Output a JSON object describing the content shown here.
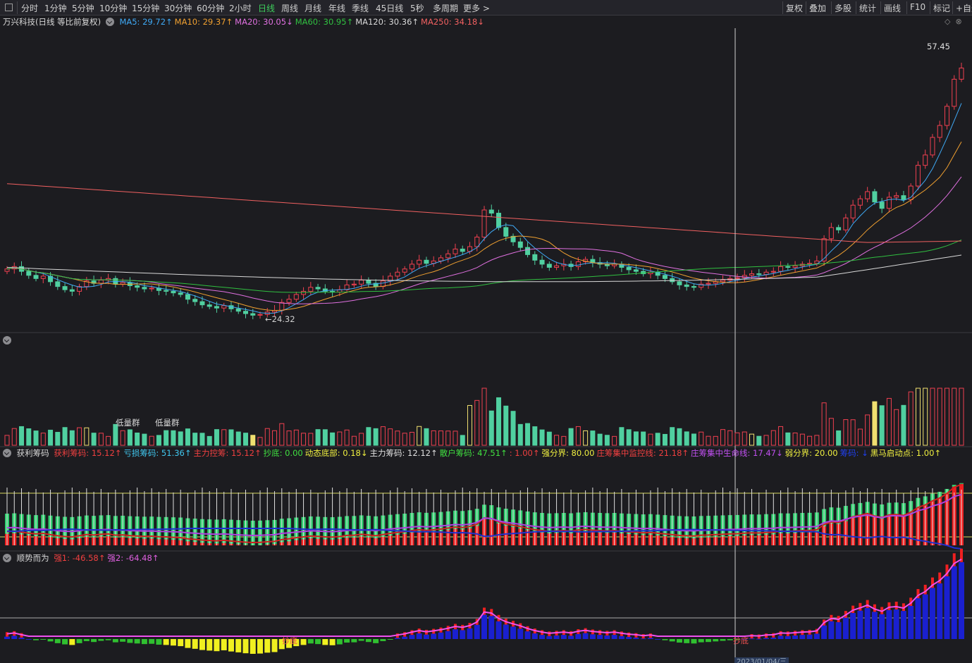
{
  "toolbar": {
    "periods": [
      "分时",
      "1分钟",
      "5分钟",
      "10分钟",
      "15分钟",
      "30分钟",
      "60分钟",
      "2小时",
      "日线",
      "周线",
      "月线",
      "年线",
      "季线",
      "45日线",
      "5秒",
      "多周期",
      "更多 >"
    ],
    "active_period": "日线",
    "right_buttons": [
      "复权",
      "叠加",
      "多股",
      "统计",
      "画线",
      "F10",
      "标记",
      "+自选"
    ]
  },
  "main_legend": {
    "title": "万兴科技(日线 等比前复权)",
    "items": [
      {
        "text": "MA5: 29.72↑",
        "color": "#3fa9f5"
      },
      {
        "text": "MA10: 29.37↑",
        "color": "#f0a030"
      },
      {
        "text": "MA20: 30.05↓",
        "color": "#e070e0"
      },
      {
        "text": "MA60: 30.95↑",
        "color": "#30c040"
      },
      {
        "text": "MA120: 30.36↑",
        "color": "#d8d8d8"
      },
      {
        "text": "MA250: 34.18↓",
        "color": "#f06060"
      }
    ]
  },
  "main_annotations": {
    "high_label": "57.45",
    "low_label": "24.32"
  },
  "volume_pane": {
    "labels": [
      "低量群",
      "低量群"
    ]
  },
  "chip_legend": {
    "title": "获利筹码",
    "items": [
      {
        "text": "获利筹码: 15.12↑",
        "color": "#f04040"
      },
      {
        "text": "亏损筹码: 51.36↑",
        "color": "#40c8f0"
      },
      {
        "text": "主力控筹: 15.12↑",
        "color": "#f04040"
      },
      {
        "text": "抄底: 0.00",
        "color": "#40e040"
      },
      {
        "text": "动态底部: 0.18↓",
        "color": "#f0f040"
      },
      {
        "text": "主力筹码: 12.12↑",
        "color": "#e0e0e0"
      },
      {
        "text": "散户筹码: 47.51↑",
        "color": "#40e040"
      },
      {
        "text": ": 1.00↑",
        "color": "#f04040"
      },
      {
        "text": "强分界: 80.00",
        "color": "#f0f040"
      },
      {
        "text": "庄筹集中监控线: 21.18↑",
        "color": "#f04040"
      },
      {
        "text": "庄筹集中生命线: 17.47↓",
        "color": "#c050f0"
      },
      {
        "text": "弱分界: 20.00",
        "color": "#f0f040"
      },
      {
        "text": "筹码: ↓",
        "color": "#2040f0"
      },
      {
        "text": "黑马启动点: 1.00↑",
        "color": "#f0f040"
      }
    ]
  },
  "trend_legend": {
    "title": "顺势而为",
    "items": [
      {
        "text": "强1: -46.58↑",
        "color": "#f04040"
      },
      {
        "text": "强2: -64.48↑",
        "color": "#e060e0"
      }
    ]
  },
  "trend_annotations": {
    "buy_label_1": "抄底",
    "buy_label_2": "抄底",
    "date_tag": "2023/01/04/三"
  },
  "colors": {
    "up": "#f04050",
    "down": "#50d0a0",
    "background": "#1c1c20"
  },
  "chart_data": {
    "type": "candlestick",
    "ylim": [
      22,
      60
    ],
    "min_label": 24.32,
    "max_label": 57.45,
    "closes": [
      29.8,
      30.1,
      29.5,
      29.0,
      28.6,
      28.9,
      28.2,
      27.6,
      27.2,
      27.0,
      27.6,
      28.3,
      28.0,
      28.4,
      28.6,
      27.9,
      28.1,
      27.7,
      27.5,
      27.3,
      27.4,
      27.1,
      27.0,
      26.8,
      26.6,
      26.0,
      25.7,
      25.3,
      25.1,
      24.9,
      25.2,
      24.8,
      24.5,
      24.2,
      24.0,
      24.1,
      24.4,
      24.6,
      25.6,
      26.0,
      26.6,
      27.0,
      27.5,
      27.3,
      27.0,
      26.9,
      27.2,
      27.8,
      27.9,
      28.4,
      28.0,
      27.6,
      28.3,
      28.9,
      29.4,
      29.8,
      30.4,
      30.9,
      30.5,
      30.8,
      31.2,
      31.7,
      32.3,
      32.0,
      32.6,
      33.8,
      37.2,
      36.8,
      35.0,
      33.9,
      33.2,
      32.5,
      31.6,
      30.9,
      30.4,
      30.0,
      30.2,
      30.4,
      30.1,
      30.7,
      31.0,
      30.6,
      30.4,
      30.2,
      30.4,
      30.0,
      29.7,
      29.5,
      29.2,
      29.4,
      29.0,
      28.6,
      28.2,
      27.8,
      27.6,
      27.5,
      27.9,
      28.0,
      28.2,
      28.4,
      28.6,
      28.7,
      29.0,
      29.2,
      29.1,
      29.4,
      29.5,
      30.1,
      30.0,
      30.2,
      30.4,
      30.5,
      30.8,
      33.6,
      35.0,
      34.7,
      36.2,
      37.8,
      38.6,
      39.5,
      38.2,
      37.4,
      38.8,
      39.0,
      38.5,
      40.2,
      42.8,
      44.1,
      46.3,
      47.8,
      50.2,
      53.6,
      55.0
    ],
    "ma5_value": 29.72,
    "ma10_value": 29.37,
    "ma20_value": 30.05,
    "ma60_value": 30.95,
    "ma120_value": 30.36,
    "ma250_value": 34.18
  }
}
